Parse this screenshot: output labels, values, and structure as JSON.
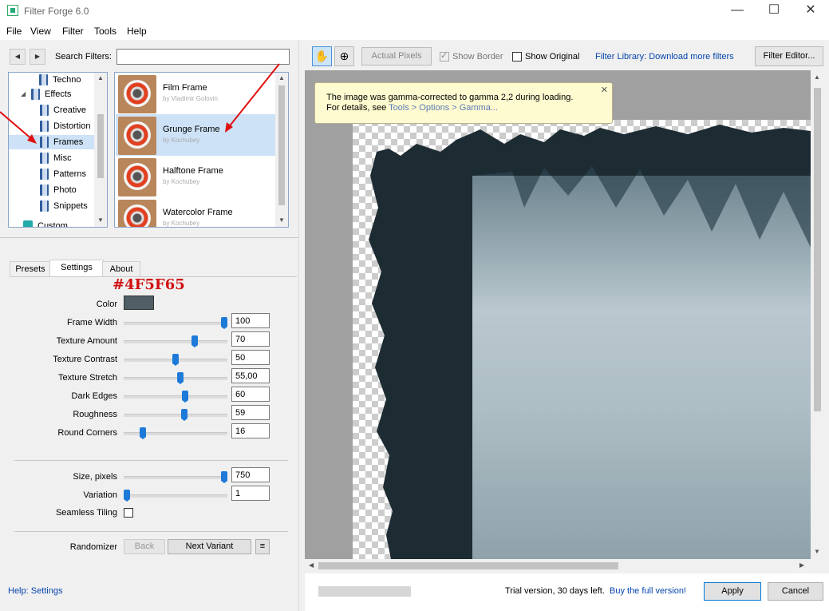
{
  "window": {
    "title": "Filter Forge 6.0",
    "min": "—",
    "max": "☐",
    "close": "✕"
  },
  "menu": [
    "File",
    "View",
    "Filter",
    "Tools",
    "Help"
  ],
  "search": {
    "label": "Search Filters:",
    "value": "",
    "placeholder": ""
  },
  "nav": {
    "back": "◀",
    "forward": "▶"
  },
  "tree": [
    {
      "label": "Techno",
      "selected": false
    },
    {
      "label": "Effects",
      "selected": false,
      "expanded": true
    },
    {
      "label": "Creative",
      "selected": false
    },
    {
      "label": "Distortion",
      "selected": false
    },
    {
      "label": "Frames",
      "selected": true
    },
    {
      "label": "Misc",
      "selected": false
    },
    {
      "label": "Patterns",
      "selected": false
    },
    {
      "label": "Photo",
      "selected": false
    },
    {
      "label": "Snippets",
      "selected": false
    },
    {
      "label": "Custom Filters",
      "selected": false
    }
  ],
  "filters": [
    {
      "name": "Film Frame",
      "author": "by Vladimir Golovin",
      "selected": false
    },
    {
      "name": "Grunge Frame",
      "author": "by Kochubey",
      "selected": true
    },
    {
      "name": "Halftone Frame",
      "author": "by Kochubey",
      "selected": false
    },
    {
      "name": "Watercolor Frame",
      "author": "by Kochubey",
      "selected": false
    }
  ],
  "tabs": [
    "Presets",
    "Settings",
    "About"
  ],
  "annotation": {
    "text": "#4F5F65",
    "color": "#d01010"
  },
  "settings": {
    "color_label": "Color",
    "color_value": "#4F5F65",
    "sliders": [
      {
        "label": "Frame Width",
        "value": "100",
        "fraction": 1.0
      },
      {
        "label": "Texture Amount",
        "value": "70",
        "fraction": 0.7
      },
      {
        "label": "Texture Contrast",
        "value": "50",
        "fraction": 0.5
      },
      {
        "label": "Texture Stretch",
        "value": "55,00",
        "fraction": 0.55
      },
      {
        "label": "Dark Edges",
        "value": "60",
        "fraction": 0.6
      },
      {
        "label": "Roughness",
        "value": "59",
        "fraction": 0.59
      },
      {
        "label": "Round Corners",
        "value": "16",
        "fraction": 0.16
      }
    ],
    "size": {
      "label": "Size, pixels",
      "value": "750",
      "fraction": 1.0
    },
    "variation": {
      "label": "Variation",
      "value": "1",
      "fraction": 0.0
    },
    "seamless": {
      "label": "Seamless Tiling",
      "checked": false
    }
  },
  "randomizer": {
    "label": "Randomizer",
    "back": "Back",
    "next": "Next Variant",
    "menu": "≡"
  },
  "help_link": "Help: Settings",
  "toolbar": {
    "actual_pixels": "Actual Pixels",
    "show_border": "Show Border",
    "show_original": "Show Original",
    "library_link": "Filter Library: Download more filters",
    "filter_editor": "Filter Editor..."
  },
  "tooltip": {
    "line1": "The image was gamma-corrected to gamma 2,2 during loading.",
    "line2_prefix": "For details, see ",
    "line2_link": "Tools > Options > Gamma...",
    "close": "✕"
  },
  "status": {
    "trial_text": "Trial version, 30 days left.",
    "buy_link": "Buy the full version!",
    "apply": "Apply",
    "cancel": "Cancel"
  },
  "colors": {
    "accent": "#1e7ad8",
    "selection": "#cde2f7",
    "frame": "#1d2b33",
    "mist": "#9fb4bd"
  }
}
